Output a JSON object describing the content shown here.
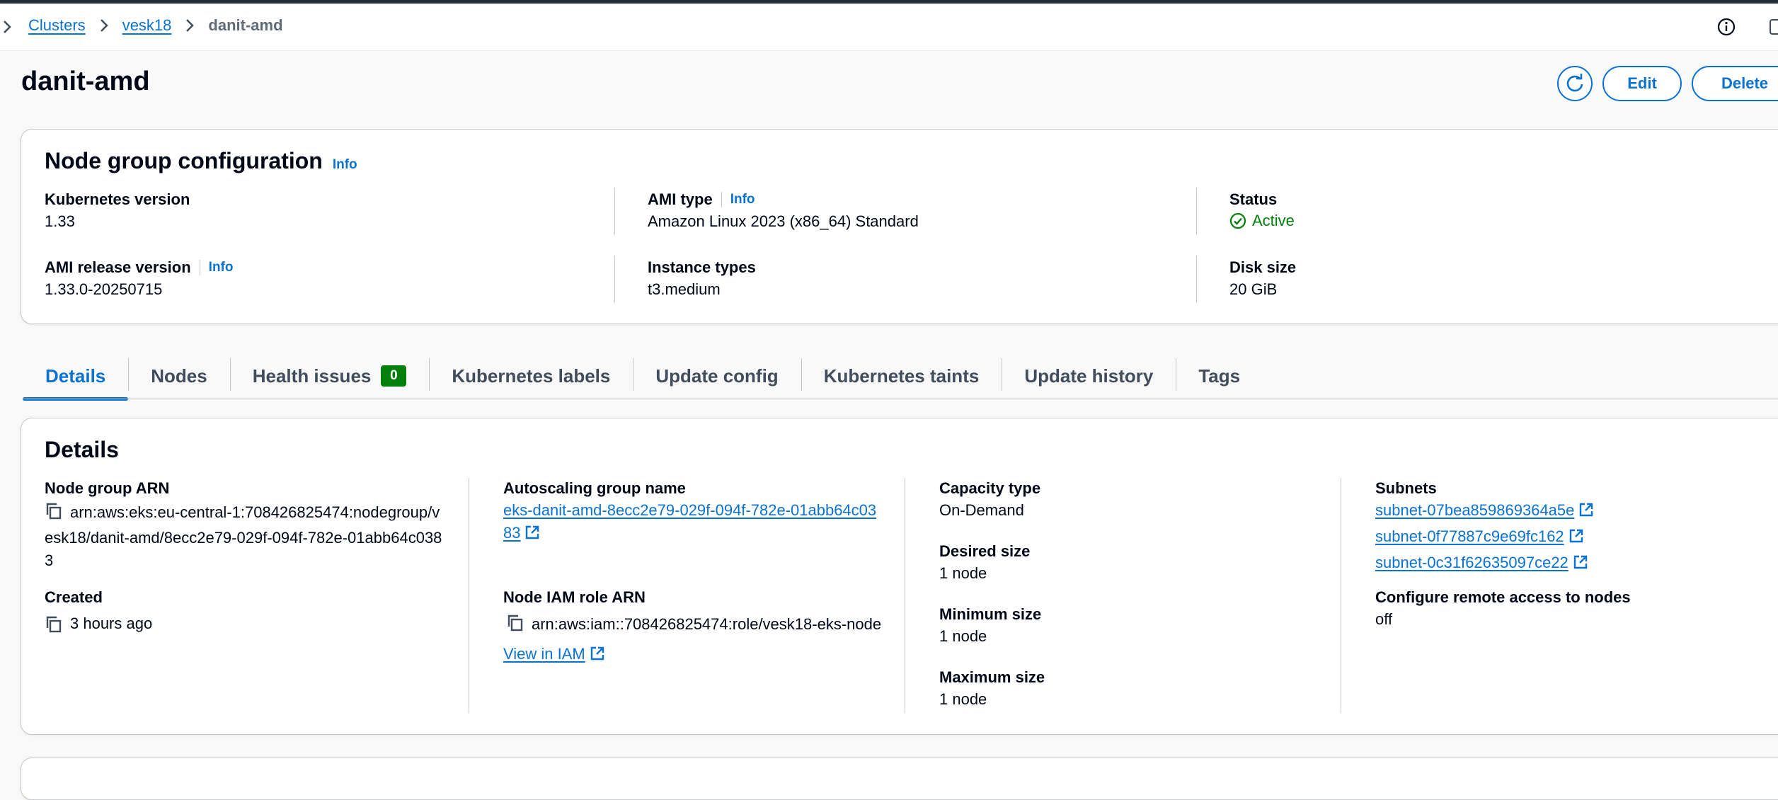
{
  "breadcrumbs": [
    {
      "label": "Clusters"
    },
    {
      "label": "vesk18"
    },
    {
      "label": "danit-amd"
    }
  ],
  "header": {
    "title": "danit-amd",
    "edit_label": "Edit",
    "delete_label": "Delete"
  },
  "config": {
    "title": "Node group configuration",
    "info": "Info",
    "kubernetes_version": {
      "label": "Kubernetes version",
      "value": "1.33"
    },
    "ami_type": {
      "label": "AMI type",
      "info": "Info",
      "value": "Amazon Linux 2023 (x86_64) Standard"
    },
    "status": {
      "label": "Status",
      "value": "Active",
      "color": "#037f0c"
    },
    "ami_release_version": {
      "label": "AMI release version",
      "info": "Info",
      "value": "1.33.0-20250715"
    },
    "instance_types": {
      "label": "Instance types",
      "value": "t3.medium"
    },
    "disk_size": {
      "label": "Disk size",
      "value": "20 GiB"
    }
  },
  "tabs": [
    {
      "label": "Details",
      "active": true
    },
    {
      "label": "Nodes"
    },
    {
      "label": "Health issues",
      "badge": "0"
    },
    {
      "label": "Kubernetes labels"
    },
    {
      "label": "Update config"
    },
    {
      "label": "Kubernetes taints"
    },
    {
      "label": "Update history"
    },
    {
      "label": "Tags"
    }
  ],
  "details": {
    "title": "Details",
    "node_group_arn": {
      "label": "Node group ARN",
      "value": "arn:aws:eks:eu-central-1:708426825474:nodegroup/vesk18/danit-amd/8ecc2e79-029f-094f-782e-01abb64c0383"
    },
    "created": {
      "label": "Created",
      "value": "3 hours ago"
    },
    "autoscaling_group": {
      "label": "Autoscaling group name",
      "value": "eks-danit-amd-8ecc2e79-029f-094f-782e-01abb64c0383"
    },
    "node_iam_role": {
      "label": "Node IAM role ARN",
      "value": "arn:aws:iam::708426825474:role/vesk18-eks-node",
      "link": "View in IAM"
    },
    "capacity_type": {
      "label": "Capacity type",
      "value": "On-Demand"
    },
    "desired_size": {
      "label": "Desired size",
      "value": "1 node"
    },
    "minimum_size": {
      "label": "Minimum size",
      "value": "1 node"
    },
    "maximum_size": {
      "label": "Maximum size",
      "value": "1 node"
    },
    "subnets": {
      "label": "Subnets",
      "items": [
        "subnet-07bea859869364a5e",
        "subnet-0f77887c9e69fc162",
        "subnet-0c31f62635097ce22"
      ]
    },
    "remote_access": {
      "label": "Configure remote access to nodes",
      "value": "off"
    }
  },
  "colors": {
    "link": "#0972d3",
    "success": "#037f0c",
    "text": "#000716",
    "border": "#c6c6cd"
  }
}
